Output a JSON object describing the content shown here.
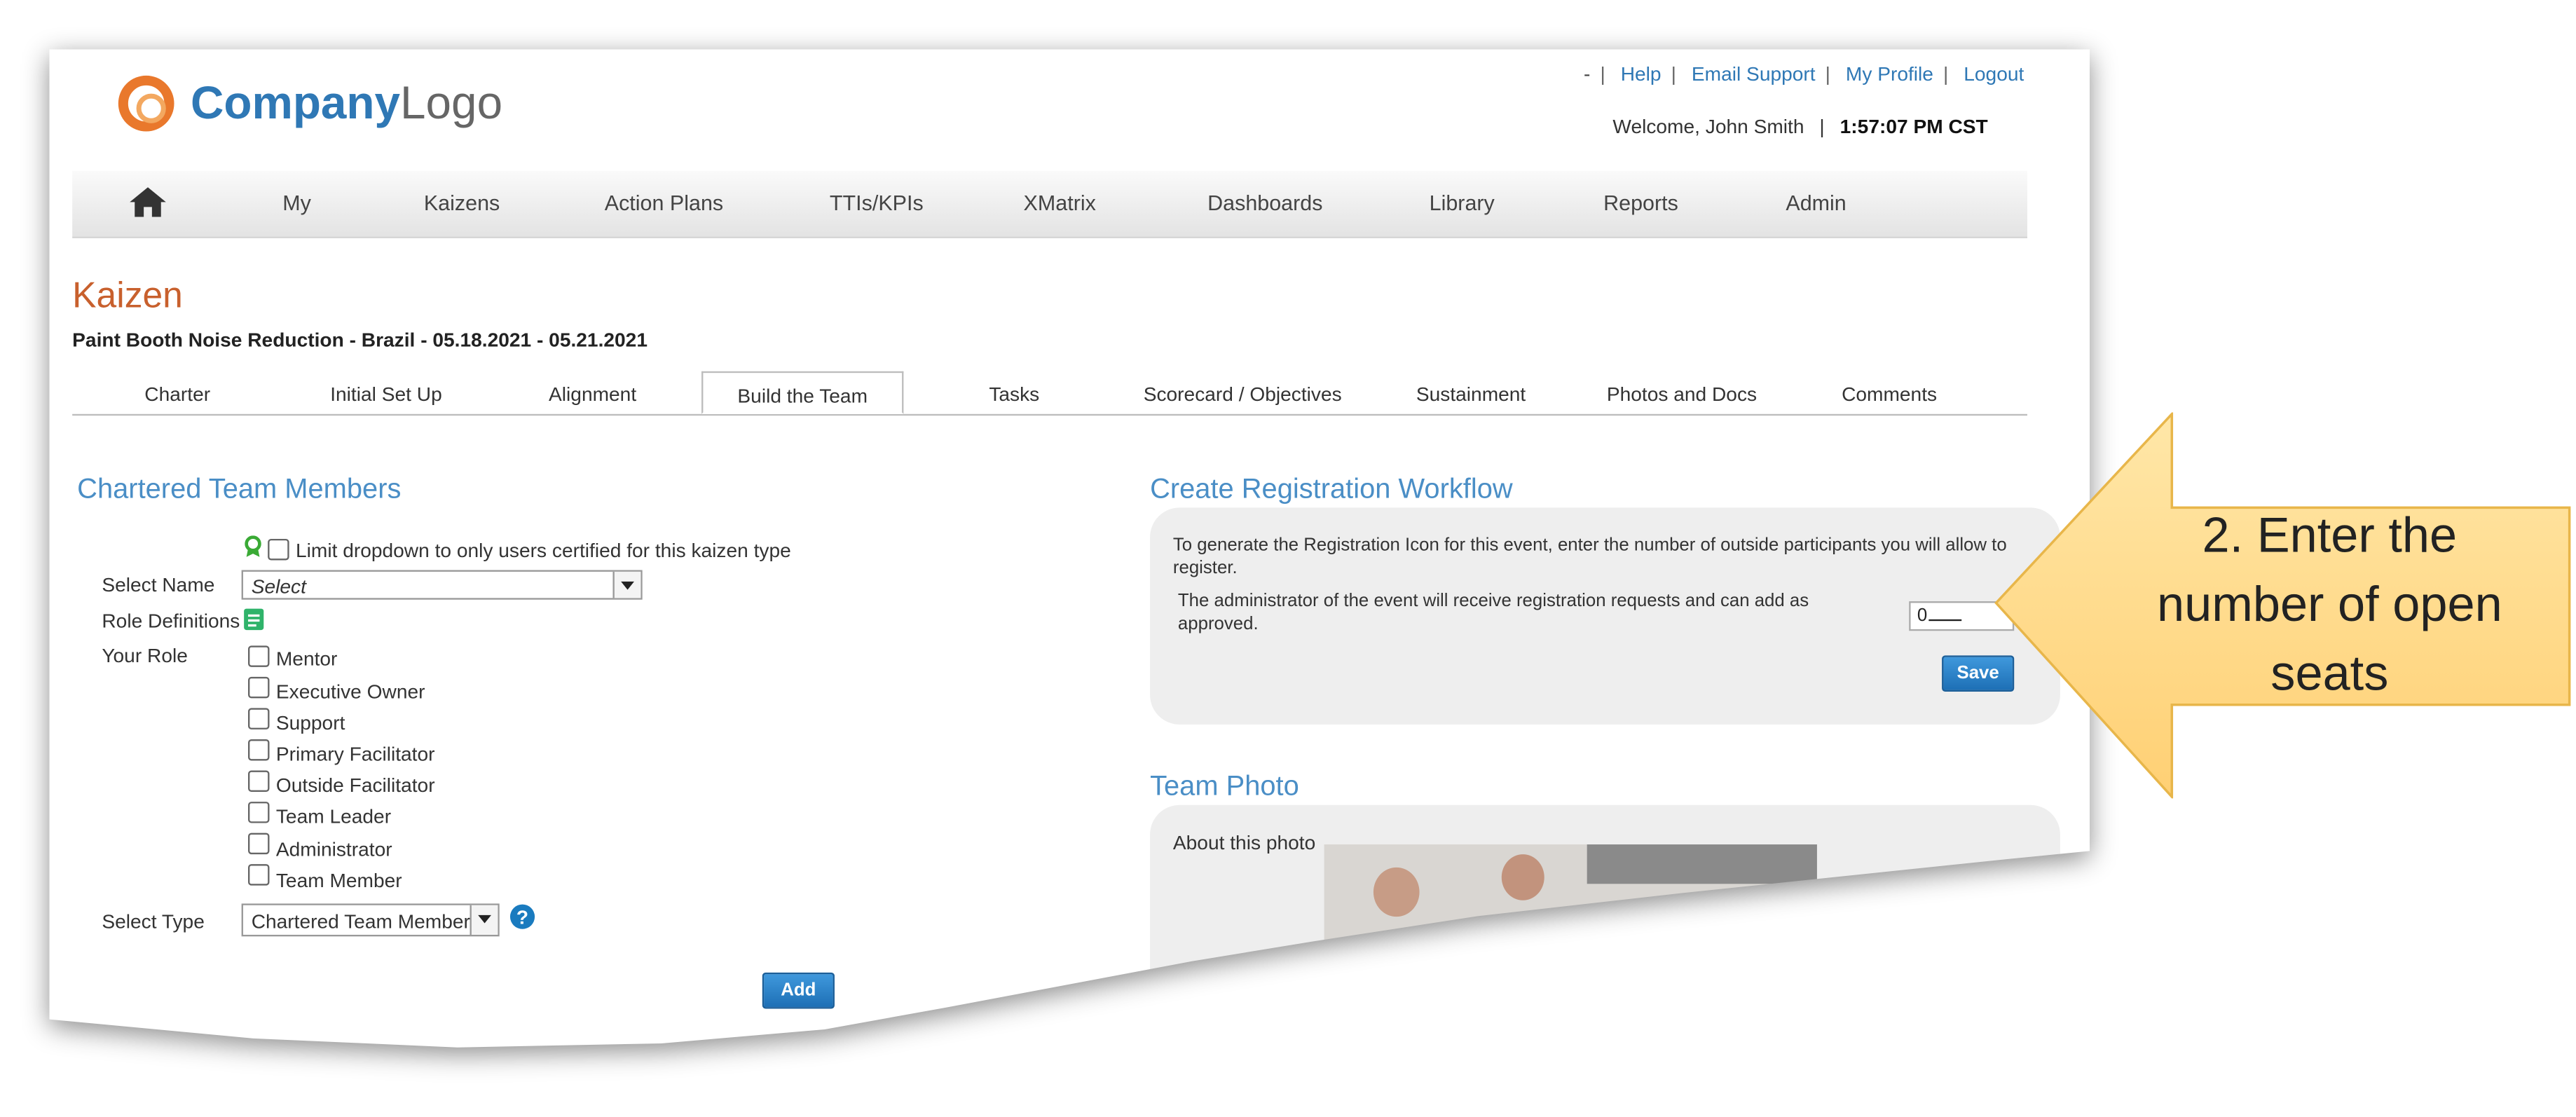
{
  "header": {
    "logo_bold": "Company",
    "logo_light": "Logo",
    "links": [
      "-",
      "Help",
      "Email Support",
      "My Profile",
      "Logout"
    ],
    "welcome_text": "Welcome, John Smith",
    "time": "1:57:07 PM CST"
  },
  "nav": {
    "items": [
      "My",
      "Kaizens",
      "Action Plans",
      "TTIs/KPIs",
      "XMatrix",
      "Dashboards",
      "Library",
      "Reports",
      "Admin"
    ]
  },
  "kaizen": {
    "title": "Kaizen",
    "subtitle": "Paint Booth Noise Reduction - Brazil - 05.18.2021 - 05.21.2021"
  },
  "tabs": [
    "Charter",
    "Initial Set Up",
    "Alignment",
    "Build the Team",
    "Tasks",
    "Scorecard / Objectives",
    "Sustainment",
    "Photos and Docs",
    "Comments"
  ],
  "team": {
    "title": "Chartered Team Members",
    "limit_label": "Limit dropdown to only users certified for this kaizen type",
    "select_name_label": "Select Name",
    "select_name_value": "Select",
    "role_definitions_label": "Role Definitions",
    "your_role_label": "Your Role",
    "roles": [
      "Mentor",
      "Executive Owner",
      "Support",
      "Primary Facilitator",
      "Outside Facilitator",
      "Team Leader",
      "Administrator",
      "Team Member"
    ],
    "select_type_label": "Select Type",
    "select_type_value": "Chartered Team Member",
    "add_label": "Add"
  },
  "registration": {
    "title": "Create Registration Workflow",
    "description": "To generate the Registration Icon for this event, enter the number of outside participants you will allow to register.",
    "admin_note": "The administrator of the event will receive registration requests and can add as approved.",
    "seats_value": "0",
    "save_label": "Save"
  },
  "photo": {
    "title": "Team Photo",
    "about_label": "About this photo"
  },
  "callout": {
    "text": "2. Enter the number of open seats"
  },
  "colors": {
    "accent_blue": "#4a8ec6",
    "kaizen_orange": "#c8602d",
    "callout_fill": "#ffd88a",
    "button_blue": "#1d6fb5"
  }
}
